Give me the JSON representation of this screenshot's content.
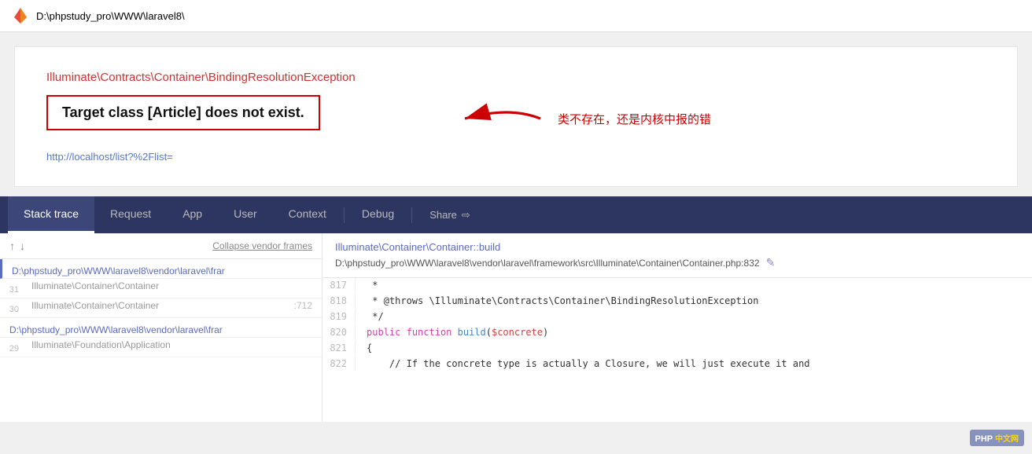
{
  "topbar": {
    "path": "D:\\phpstudy_pro\\WWW\\laravel8\\"
  },
  "errorCard": {
    "exceptionClass": "Illuminate\\Contracts\\Container\\BindingResolutionException",
    "message": "Target class [Article] does not exist.",
    "url": "http://localhost/list?%2Flist=",
    "annotation": "类不存在，还是内核中报的错"
  },
  "tabs": {
    "items": [
      {
        "label": "Stack trace",
        "active": true
      },
      {
        "label": "Request",
        "active": false
      },
      {
        "label": "App",
        "active": false
      },
      {
        "label": "User",
        "active": false
      },
      {
        "label": "Context",
        "active": false
      },
      {
        "label": "Debug",
        "active": false
      },
      {
        "label": "Share",
        "active": false,
        "icon": "share-icon"
      }
    ]
  },
  "stackPanel": {
    "collapseLabel": "Collapse vendor frames",
    "frames": [
      {
        "number": "",
        "file": "D:\\phpstudy_pro\\WWW\\laravel8\\vendor\\laravel\\frar",
        "class": "",
        "line": "",
        "active": true
      },
      {
        "number": "31",
        "file": "",
        "class": "Illuminate\\Container\\Container",
        "line": "",
        "active": false
      },
      {
        "number": "30",
        "file": "",
        "class": "Illuminate\\Container\\Container",
        "line": ":712",
        "active": false
      },
      {
        "number": "",
        "file": "D:\\phpstudy_pro\\WWW\\laravel8\\vendor\\laravel\\frar",
        "class": "",
        "line": "",
        "active": false
      },
      {
        "number": "29",
        "file": "",
        "class": "Illuminate\\Foundation\\Application",
        "line": "",
        "active": false
      }
    ]
  },
  "codePanel": {
    "className": "Illuminate\\Container\\Container::build",
    "filePath": "D:\\phpstudy_pro\\WWW\\laravel8\\vendor\\laravel\\framework\\src\\Illuminate\\Container\\Container.php:832",
    "lines": [
      {
        "number": "817",
        "content": " *"
      },
      {
        "number": "818",
        "content": " * @throws \\Illuminate\\Contracts\\Container\\BindingResolutionException"
      },
      {
        "number": "819",
        "content": " */"
      },
      {
        "number": "820",
        "content": "public function build($concrete)"
      },
      {
        "number": "821",
        "content": "{"
      },
      {
        "number": "822",
        "content": "    // If the concrete type is actually a Closure, we will just execute it and"
      }
    ]
  },
  "phpBadge": {
    "label": "PHP",
    "site": "中文网"
  }
}
